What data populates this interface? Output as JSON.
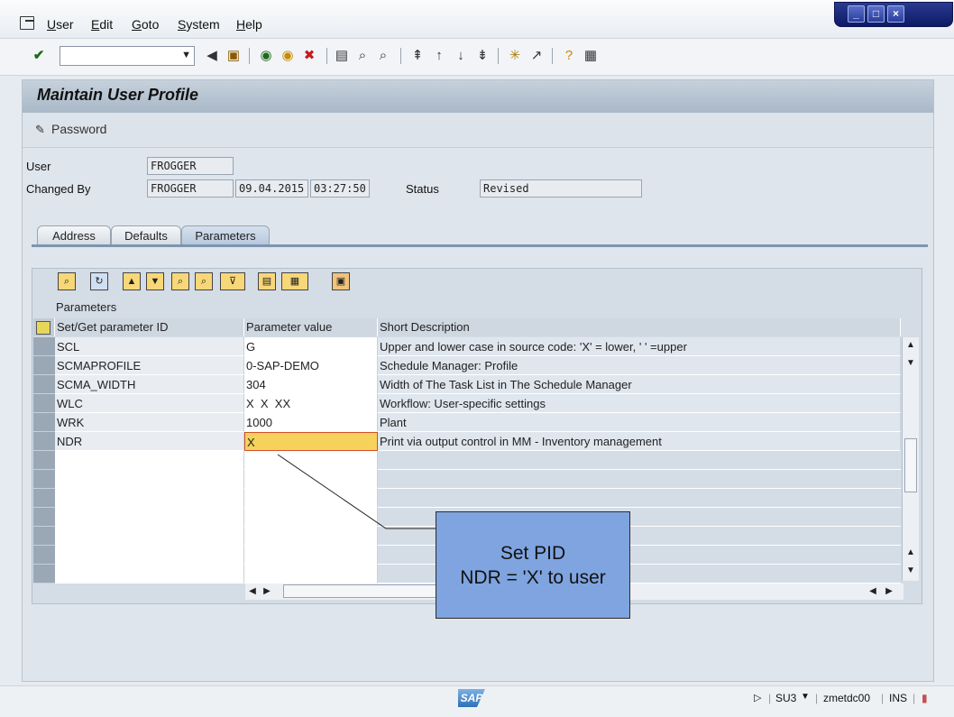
{
  "menubar": {
    "items": [
      "User",
      "Edit",
      "Goto",
      "System",
      "Help"
    ]
  },
  "window_controls": [
    "minimize",
    "maximize",
    "close"
  ],
  "toolbar": {
    "command_field_value": "",
    "icons": [
      "enter-icon",
      "back-icon",
      "save-icon",
      "back-green-icon",
      "exit-icon",
      "cancel-icon",
      "print-icon",
      "find-icon",
      "find-next-icon",
      "first-page-icon",
      "prev-page-icon",
      "next-page-icon",
      "last-page-icon",
      "create-session-icon",
      "shortcut-icon",
      "help-icon",
      "layout-icon"
    ]
  },
  "page": {
    "title": "Maintain User Profile",
    "app_toolbar": {
      "password_label": "Password"
    }
  },
  "header_fields": {
    "user_label": "User",
    "user_value": "FROGGER",
    "changed_by_label": "Changed By",
    "changed_by_value": "FROGGER",
    "date": "09.04.2015",
    "time": "03:27:50",
    "status_label": "Status",
    "status_value": "Revised"
  },
  "tabs": [
    "Address",
    "Defaults",
    "Parameters"
  ],
  "active_tab": "Parameters",
  "parameters": {
    "caption": "Parameters",
    "columns": [
      "Set/Get parameter ID",
      "Parameter value",
      "Short Description"
    ],
    "rows": [
      {
        "id": "SCL",
        "value": "G",
        "desc": "Upper and lower case in source code: 'X' = lower, ' ' =upper"
      },
      {
        "id": "SCMAPROFILE",
        "value": "0-SAP-DEMO",
        "desc": "Schedule Manager: Profile"
      },
      {
        "id": "SCMA_WIDTH",
        "value": "304",
        "desc": "Width of The Task List in The Schedule Manager"
      },
      {
        "id": "WLC",
        "value": "X  X  XX",
        "desc": "Workflow: User-specific settings"
      },
      {
        "id": "WRK",
        "value": "1000",
        "desc": "Plant"
      },
      {
        "id": "NDR",
        "value": "X",
        "desc": "Print via output control in MM - Inventory management"
      }
    ],
    "empty_rows": 7
  },
  "callout": {
    "line1": "Set PID",
    "line2": "NDR = 'X' to user"
  },
  "statusbar": {
    "logo": "SAP",
    "transaction": "SU3",
    "server": "zmetdc00",
    "mode": "INS"
  },
  "colors": {
    "accent": "#7fa4df",
    "focus_cell": "#f6d25c",
    "title_bar": "#b3c1cf"
  }
}
